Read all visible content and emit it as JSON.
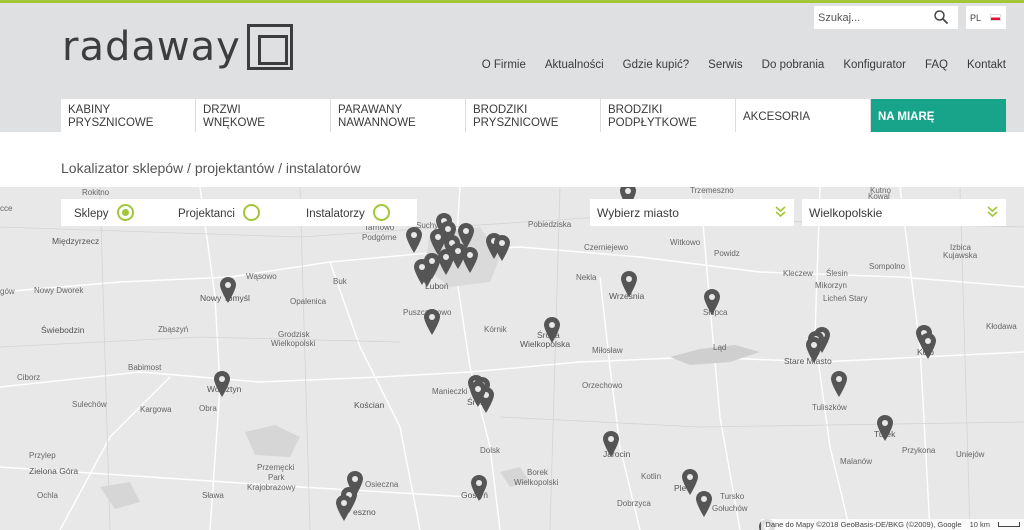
{
  "brand": {
    "logo_text": "radaway"
  },
  "search": {
    "placeholder": "Szukaj..."
  },
  "language": {
    "code": "PL"
  },
  "top_nav": [
    "O Firmie",
    "Aktualności",
    "Gdzie kupić?",
    "Serwis",
    "Do pobrania",
    "Konfigurator",
    "FAQ",
    "Kontakt"
  ],
  "main_nav": [
    {
      "line1": "KABINY",
      "line2": "PRYSZNICOWE"
    },
    {
      "line1": "DRZWI",
      "line2": "WNĘKOWE"
    },
    {
      "line1": "PARAWANY",
      "line2": "NAWANNOWE"
    },
    {
      "line1": "BRODZIKI",
      "line2": "PRYSZNICOWE"
    },
    {
      "line1": "BRODZIKI",
      "line2": "PODPŁYTKOWE"
    },
    {
      "line1": "AKCESORIA",
      "line2": ""
    },
    {
      "line1": "NA MIARĘ",
      "line2": ""
    }
  ],
  "page_title": "Lokalizator sklepów / projektantów / instalatorów",
  "filters": {
    "sklepy": {
      "label": "Sklepy",
      "checked": true
    },
    "projektanci": {
      "label": "Projektanci",
      "checked": false
    },
    "instalatorzy": {
      "label": "Instalatorzy",
      "checked": false
    }
  },
  "city_select": {
    "value": "Wybierz miasto"
  },
  "region_select": {
    "value": "Wielkopolskie"
  },
  "map": {
    "labels": {
      "rokitno": "Rokitno",
      "cce": "cce",
      "midzyrzecz": "Międzyrzecz",
      "tarnowo": "Tarnowo",
      "podgorne": "Podgórne",
      "suchy": "Suchy",
      "pobiedziska": "Pobiedziska",
      "tremeszno": "Trzemeszno",
      "czerniejewo": "Czerniejewo",
      "witkowo": "Witkowo",
      "powidz": "Powidz",
      "slesin": "Ślesin",
      "kleczew": "Kleczew",
      "sompolno": "Sompolno",
      "izbica": "Izbica",
      "kujawska": "Kujawska",
      "kutno": "Kutno",
      "kowal": "Kowal",
      "wasowo": "Wąsowo",
      "buk": "Buk",
      "nekla": "Nekla",
      "mikorzyn": "Mikorzyn",
      "now_dwor": "Nowy Dworek",
      "nowy_tomysl": "Nowy Tomyśl",
      "opalenica": "Opalenica",
      "lubon": "Luboń",
      "wrzesnia": "Września",
      "slupca": "Słupca",
      "lichen": "Licheń Stary",
      "gow": "gów",
      "swiebodzin": "Świebodzin",
      "zbaszyn": "Zbąszyń",
      "puszczykowo": "Puszczykowo",
      "kornik": "Kórnik",
      "sroda": "Środa",
      "wielkopolska": "Wielkopolska",
      "klodawa": "Kłodawa",
      "grodzisk": "Grodzisk",
      "wlkp": "Wielkopolski",
      "milostaw": "Miłosław",
      "lad": "Ląd",
      "stare_miasto": "Stare Miasto",
      "kolo": "Koło",
      "babimost": "Babimost",
      "ciborz": "Ciborz",
      "wolsztyn": "Wolsztyn",
      "orzechowo": "Orzechowo",
      "manieczki": "Manieczki",
      "srem": "Śrem",
      "sulechow": "Sulechów",
      "kargowa": "Kargowa",
      "obra": "Obra",
      "koscian": "Kościan",
      "tuliszkow": "Tuliszków",
      "przylep": "Przylep",
      "dolsk": "Dolsk",
      "jarocin": "Jarocin",
      "turek": "Turek",
      "zielona_gora": "Zielona Góra",
      "przemecki": "Przemęcki",
      "park": "Park",
      "krajobrazowy": "Krajobrazowy",
      "przykona": "Przykona",
      "uniejow": "Uniejów",
      "borek": "Borek",
      "borek_wlkp": "Wielkopolski",
      "kotlin": "Kotlin",
      "malanow": "Malanów",
      "ochla": "Ochla",
      "slawa": "Sława",
      "osieczna": "Osieczna",
      "leszno": "eszno",
      "gostyn": "Gostyń",
      "dobrzyca": "Dobrzyca",
      "pleszew": "Ple",
      "tursko": "Tursko",
      "goluchow": "Gołuchów"
    },
    "attribution": "Dane do Mapy ©2018 GeoBasis-DE/BKG (©2009), Google",
    "scale": "10 km"
  }
}
